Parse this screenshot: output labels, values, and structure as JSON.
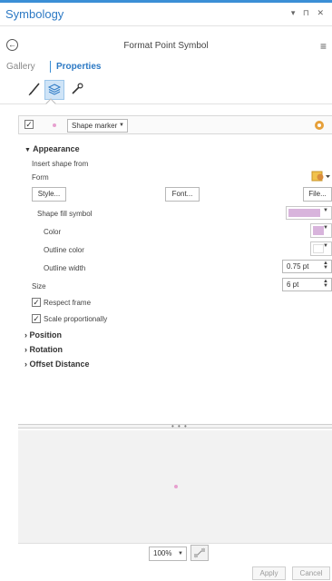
{
  "window": {
    "title": "Symbology",
    "controls": "▾ ⊓ ✕"
  },
  "header": {
    "panel_title": "Format Point Symbol",
    "back_glyph": "←",
    "menu_glyph": "≡"
  },
  "tabs": {
    "gallery": "Gallery",
    "properties": "Properties"
  },
  "icon_tabs": [
    {
      "name": "symbol",
      "active": false
    },
    {
      "name": "layers",
      "active": true
    },
    {
      "name": "properties",
      "active": false
    }
  ],
  "layer": {
    "enabled": true,
    "marker_type": "Shape marker"
  },
  "appearance": {
    "title": "Appearance",
    "insert_shape_from": "Insert shape from",
    "form_label": "Form",
    "style_button": "Style...",
    "font_button": "Font...",
    "file_button": "File...",
    "shape_fill_symbol": "Shape fill symbol",
    "color_label": "Color",
    "outline_color_label": "Outline color",
    "outline_width_label": "Outline width",
    "outline_width_value": "0.75 pt",
    "size_label": "Size",
    "size_value": "6 pt",
    "respect_frame": "Respect frame",
    "respect_frame_checked": true,
    "scale_proportionally": "Scale proportionally",
    "scale_proportionally_checked": true
  },
  "sections": [
    "Position",
    "Rotation",
    "Offset Distance"
  ],
  "colors": {
    "accent": "#2c79c4",
    "fill": "#d8b4dc",
    "symbol": "#e7a0cf"
  },
  "preview": {
    "zoom": "100%"
  },
  "footer": {
    "apply": "Apply",
    "cancel": "Cancel"
  }
}
